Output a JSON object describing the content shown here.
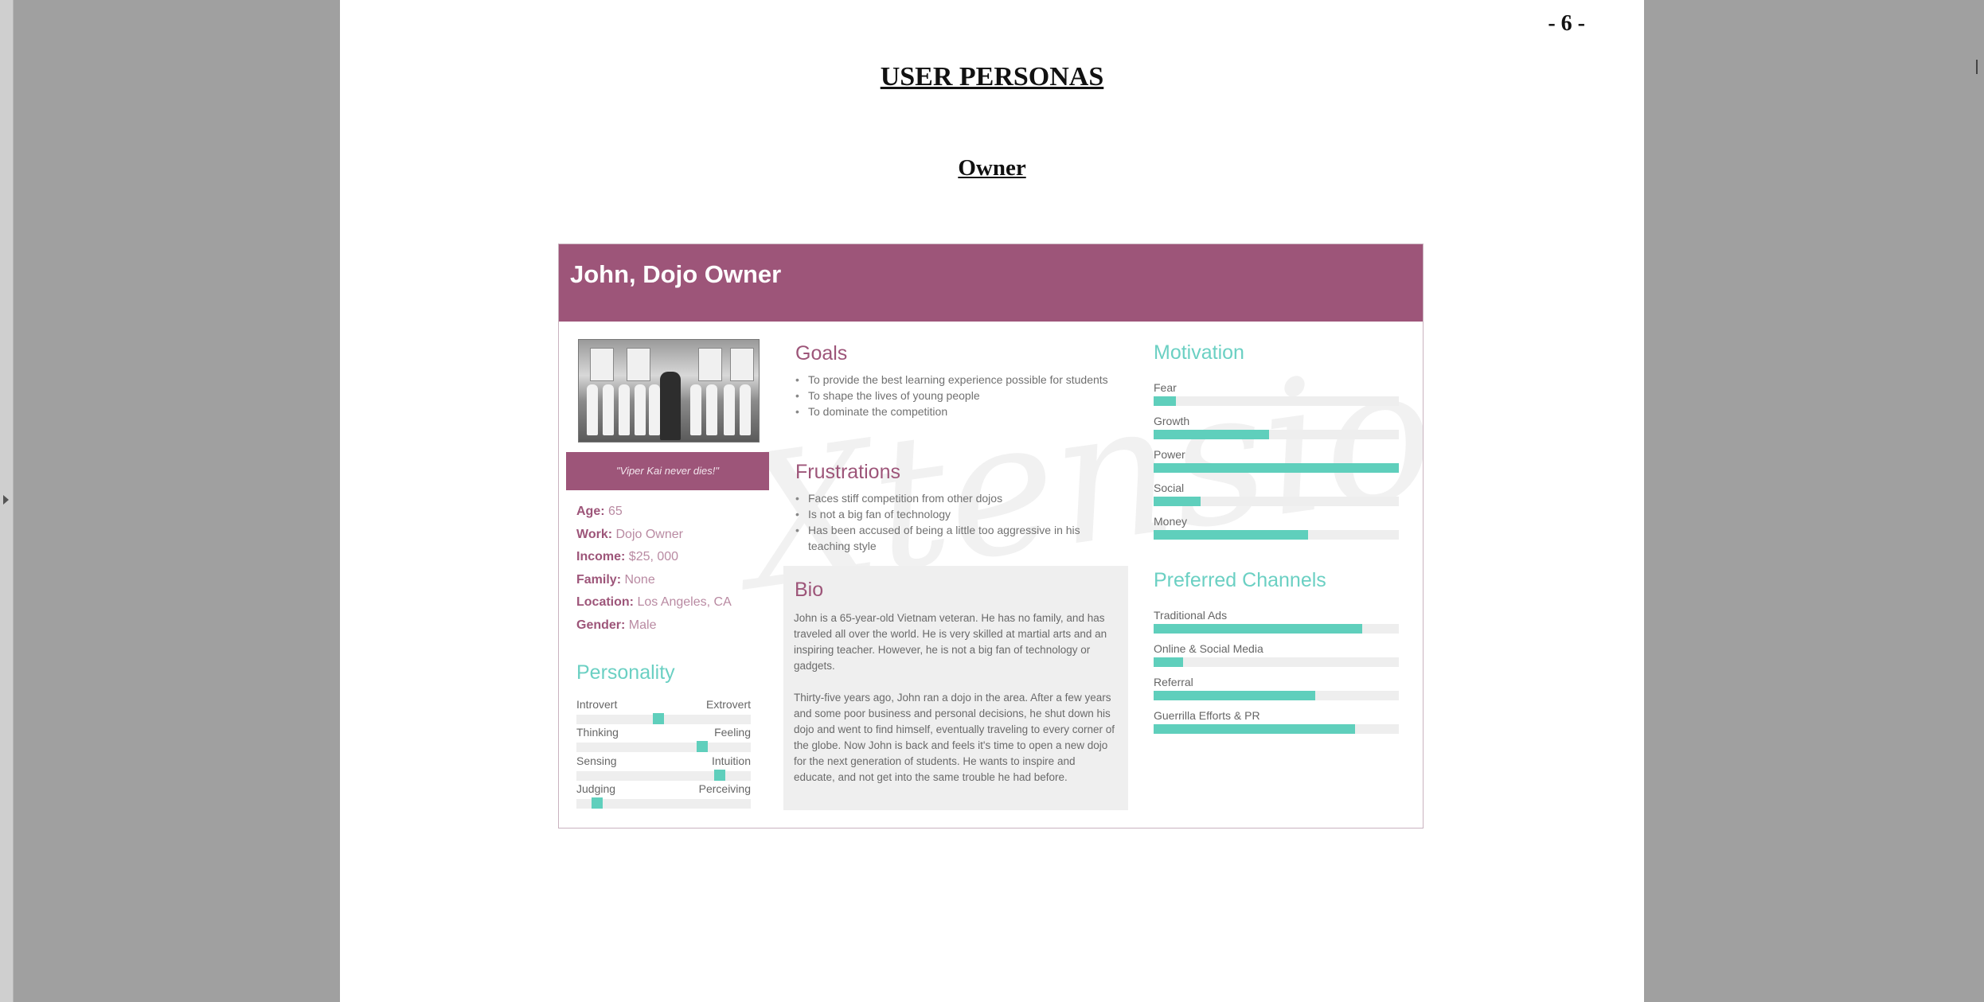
{
  "page_number": "- 6 -",
  "doc_title": "USER PERSONAS",
  "section_title": "Owner",
  "persona": {
    "name": "John, Dojo Owner",
    "quote": "\"Viper Kai never dies!\"",
    "watermark": "Xtensio",
    "info": [
      {
        "key": "Age",
        "sep": ": ",
        "value": "65"
      },
      {
        "key": "Work",
        "sep": ": ",
        "value": "Dojo Owner"
      },
      {
        "key": "Income",
        "sep": ": ",
        "value": "$25, 000"
      },
      {
        "key": "Family:",
        "sep": " ",
        "value": "None"
      },
      {
        "key": "Location:",
        "sep": " ",
        "value": "Los Angeles, CA"
      },
      {
        "key": "Gender:",
        "sep": " ",
        "value": "Male"
      }
    ],
    "personality": {
      "title": "Personality",
      "traits": [
        {
          "left": "Introvert",
          "right": "Extrovert",
          "level": 0.47
        },
        {
          "left": "Thinking",
          "right": "Feeling",
          "level": 0.72
        },
        {
          "left": "Sensing",
          "right": "Intuition",
          "level": 0.82
        },
        {
          "left": "Judging",
          "right": "Perceiving",
          "level": 0.12
        }
      ]
    },
    "goals": {
      "title": "Goals",
      "items": [
        "To provide the best learning experience possible for students",
        "To shape the lives of young people",
        "To dominate the competition"
      ]
    },
    "frustrations": {
      "title": "Frustrations",
      "items": [
        "Faces stiff competition from other dojos",
        "Is not a big fan of technology",
        "Has been accused of being a little too aggressive in his teaching style"
      ]
    },
    "bio": {
      "title": "Bio",
      "paragraphs": [
        "John is a 65-year-old Vietnam veteran. He has no family, and has traveled all over the world. He is very skilled at martial arts and an inspiring teacher. However, he is not a big fan of technology or gadgets.",
        "Thirty-five years ago, John ran a dojo in the area. After a few years and some poor business and personal decisions, he shut down his dojo and went to find himself, eventually traveling to every corner of the globe. Now John is back and feels it's time to open a new dojo for the next generation of students. He wants to inspire and educate, and not get into the same trouble he had before."
      ]
    },
    "motivation": {
      "title": "Motivation",
      "items": [
        {
          "label": "Fear",
          "level": 0.09
        },
        {
          "label": "Growth",
          "level": 0.47
        },
        {
          "label": "Power",
          "level": 1.0
        },
        {
          "label": "Social",
          "level": 0.19
        },
        {
          "label": "Money",
          "level": 0.63
        }
      ]
    },
    "channels": {
      "title": "Preferred Channels",
      "items": [
        {
          "label": "Traditional Ads",
          "level": 0.85
        },
        {
          "label": "Online & Social Media",
          "level": 0.12
        },
        {
          "label": "Referral",
          "level": 0.66
        },
        {
          "label": "Guerrilla Efforts & PR",
          "level": 0.82
        }
      ]
    },
    "colors": {
      "header": "#9d5579",
      "accent": "#5fcfbc",
      "teal_title": "#6bd0c3"
    }
  }
}
